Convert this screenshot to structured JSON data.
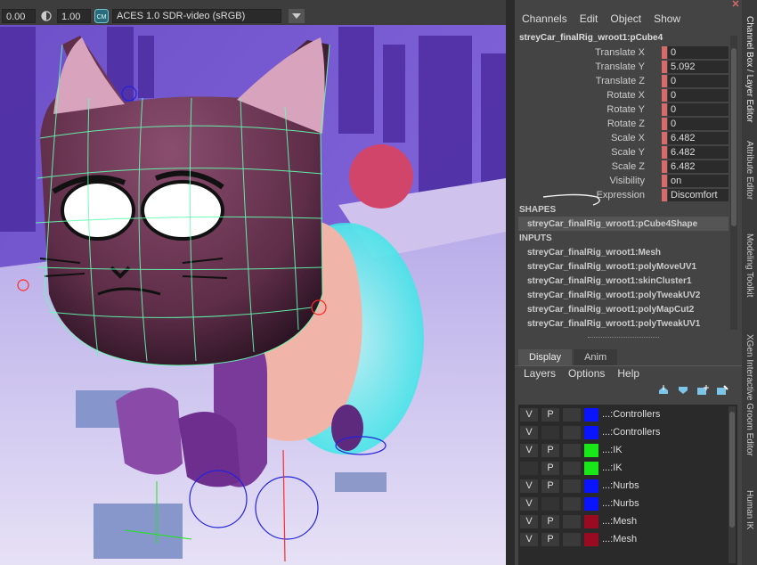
{
  "viewport": {
    "exposure": "0.00",
    "gamma": "1.00",
    "cm_badge": "CM",
    "color_space": "ACES 1.0 SDR-video (sRGB)"
  },
  "channel_box": {
    "menu": [
      "Channels",
      "Edit",
      "Object",
      "Show"
    ],
    "object_name": "streyCar_finalRig_wroot1:pCube4",
    "attributes": [
      {
        "label": "Translate X",
        "value": "0"
      },
      {
        "label": "Translate Y",
        "value": "5.092"
      },
      {
        "label": "Translate Z",
        "value": "0"
      },
      {
        "label": "Rotate X",
        "value": "0"
      },
      {
        "label": "Rotate Y",
        "value": "0"
      },
      {
        "label": "Rotate Z",
        "value": "0"
      },
      {
        "label": "Scale X",
        "value": "6.482"
      },
      {
        "label": "Scale Y",
        "value": "6.482"
      },
      {
        "label": "Scale Z",
        "value": "6.482"
      },
      {
        "label": "Visibility",
        "value": "on"
      },
      {
        "label": "Expression",
        "value": "Discomfort"
      }
    ],
    "shapes_header": "SHAPES",
    "shape": "streyCar_finalRig_wroot1:pCube4Shape",
    "inputs_header": "INPUTS",
    "inputs": [
      "streyCar_finalRig_wroot1:Mesh",
      "streyCar_finalRig_wroot1:polyMoveUV1",
      "streyCar_finalRig_wroot1:skinCluster1",
      "streyCar_finalRig_wroot1:polyTweakUV2",
      "streyCar_finalRig_wroot1:polyMapCut2",
      "streyCar_finalRig_wroot1:polyTweakUV1"
    ]
  },
  "layer_editor": {
    "tabs": [
      "Display",
      "Anim"
    ],
    "menu": [
      "Layers",
      "Options",
      "Help"
    ],
    "layers": [
      {
        "v": "V",
        "p": "P",
        "color": "#0a14ff",
        "name": "...:Controllers",
        "dim": false
      },
      {
        "v": "V",
        "p": "",
        "color": "#0a14ff",
        "name": "...:Controllers",
        "dim": false
      },
      {
        "v": "V",
        "p": "P",
        "color": "#18e818",
        "name": "...:IK",
        "dim": false
      },
      {
        "v": "",
        "p": "P",
        "color": "#18e818",
        "name": "...:IK",
        "dim": true
      },
      {
        "v": "V",
        "p": "P",
        "color": "#0a14ff",
        "name": "...:Nurbs",
        "dim": false
      },
      {
        "v": "V",
        "p": "",
        "color": "#0a14ff",
        "name": "...:Nurbs",
        "dim": false
      },
      {
        "v": "V",
        "p": "P",
        "color": "#9a0a20",
        "name": "...:Mesh",
        "dim": false
      },
      {
        "v": "V",
        "p": "P",
        "color": "#9a0a20",
        "name": "...:Mesh",
        "dim": false
      }
    ]
  },
  "side_tabs": [
    "Channel Box / Layer Editor",
    "Attribute Editor",
    "Modeling Toolkit",
    "XGen Interactive Groom Editor",
    "Human IK"
  ]
}
